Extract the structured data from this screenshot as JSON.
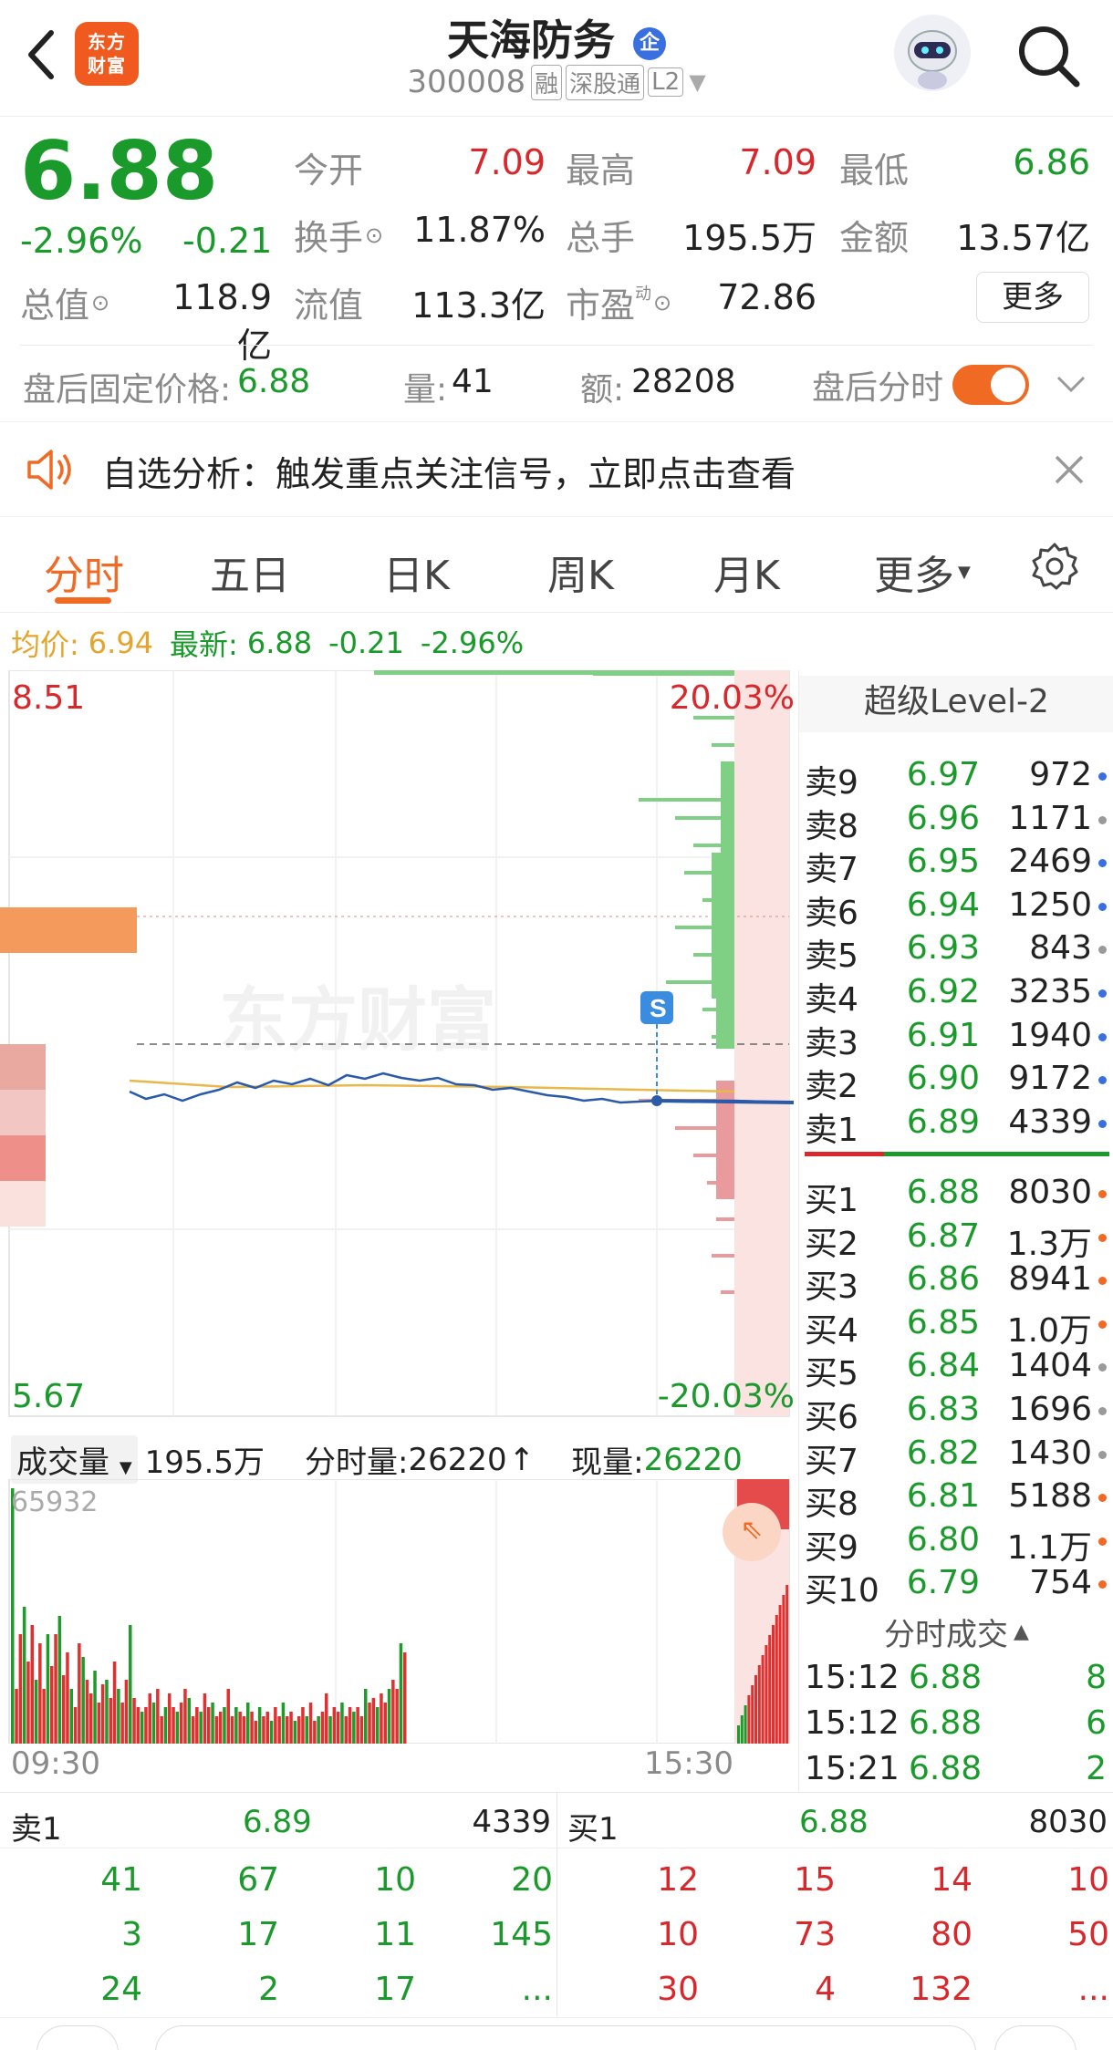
{
  "header": {
    "title": "天海防务",
    "title_badge": "企",
    "code": "300008",
    "tags": [
      "融",
      "深股通",
      "L2"
    ],
    "logo_text": "东方财富"
  },
  "quote": {
    "price": "6.88",
    "pct": "-2.96%",
    "chg": "-0.21",
    "rows": [
      [
        {
          "k": "今开",
          "v": "7.09",
          "c": "red"
        },
        {
          "k": "最高",
          "v": "7.09",
          "c": "red"
        },
        {
          "k": "最低",
          "v": "6.86",
          "c": "green"
        }
      ],
      [
        {
          "k": "换手",
          "v": "11.87%",
          "c": "dark"
        },
        {
          "k": "总手",
          "v": "195.5万",
          "c": "dark"
        },
        {
          "k": "金额",
          "v": "13.57亿",
          "c": "dark"
        }
      ],
      [
        {
          "k": "总值",
          "v": "118.9亿",
          "c": "dark"
        },
        {
          "k": "流值",
          "v": "113.3亿",
          "c": "dark"
        },
        {
          "k": "市盈",
          "v": "72.86",
          "c": "dark"
        }
      ]
    ],
    "pe_super": "动",
    "more_button": "更多"
  },
  "after_hours": {
    "fixed_price_label": "盘后固定价格:",
    "fixed_price": "6.88",
    "vol_label": "量:",
    "vol": "41",
    "amt_label": "额:",
    "amt": "28208",
    "toggle_label": "盘后分时",
    "toggle_on": true
  },
  "notice": {
    "text": "自选分析：触发重点关注信号，立即点击查看"
  },
  "tabs": [
    "分时",
    "五日",
    "日K",
    "周K",
    "月K",
    "更多"
  ],
  "active_tab": 0,
  "legend": {
    "avg_label": "均价:",
    "avg_value": "6.94",
    "latest_label": "最新:",
    "latest_value": "6.88",
    "latest_chg": "-0.21",
    "latest_pct": "-2.96%"
  },
  "chart": {
    "top_price": "8.51",
    "bottom_price": "5.67",
    "top_pct": "20.03%",
    "bottom_pct": "-20.03%",
    "watermark": "东方财富",
    "signal_badge": "S",
    "volume_selector": "成交量",
    "volume_total": "195.5万",
    "tick_vol_label": "分时量:",
    "tick_vol": "26220",
    "current_vol_label": "现量:",
    "current_vol": "26220",
    "volume_max": "65932",
    "time_start": "09:30",
    "time_end": "15:30",
    "colors": {
      "up": "#e03030",
      "down": "#1e9b2a",
      "price_line": "#2a5aa8",
      "avg_line": "#e8b84a"
    }
  },
  "order_book": {
    "title": "超级Level-2",
    "asks": [
      {
        "label": "卖9",
        "price": "6.97",
        "vol": "972",
        "dot": "blue"
      },
      {
        "label": "卖8",
        "price": "6.96",
        "vol": "1171",
        "dot": "gray"
      },
      {
        "label": "卖7",
        "price": "6.95",
        "vol": "2469",
        "dot": "blue"
      },
      {
        "label": "卖6",
        "price": "6.94",
        "vol": "1250",
        "dot": "blue"
      },
      {
        "label": "卖5",
        "price": "6.93",
        "vol": "843",
        "dot": "gray"
      },
      {
        "label": "卖4",
        "price": "6.92",
        "vol": "3235",
        "dot": "blue"
      },
      {
        "label": "卖3",
        "price": "6.91",
        "vol": "1940",
        "dot": "blue"
      },
      {
        "label": "卖2",
        "price": "6.90",
        "vol": "9172",
        "dot": "blue"
      },
      {
        "label": "卖1",
        "price": "6.89",
        "vol": "4339",
        "dot": "blue"
      }
    ],
    "bids": [
      {
        "label": "买1",
        "price": "6.88",
        "vol": "8030",
        "dot": "orange"
      },
      {
        "label": "买2",
        "price": "6.87",
        "vol": "1.3万",
        "dot": "orange"
      },
      {
        "label": "买3",
        "price": "6.86",
        "vol": "8941",
        "dot": "orange"
      },
      {
        "label": "买4",
        "price": "6.85",
        "vol": "1.0万",
        "dot": "orange"
      },
      {
        "label": "买5",
        "price": "6.84",
        "vol": "1404",
        "dot": "gray"
      },
      {
        "label": "买6",
        "price": "6.83",
        "vol": "1696",
        "dot": "gray"
      },
      {
        "label": "买7",
        "price": "6.82",
        "vol": "1430",
        "dot": "gray"
      },
      {
        "label": "买8",
        "price": "6.81",
        "vol": "5188",
        "dot": "orange"
      },
      {
        "label": "买9",
        "price": "6.80",
        "vol": "1.1万",
        "dot": "orange"
      },
      {
        "label": "买10",
        "price": "6.79",
        "vol": "754",
        "dot": "orange"
      }
    ],
    "ticks_title": "分时成交",
    "ticks": [
      {
        "time": "15:12",
        "price": "6.88",
        "vol": "8"
      },
      {
        "time": "15:12",
        "price": "6.88",
        "vol": "6"
      },
      {
        "time": "15:21",
        "price": "6.88",
        "vol": "2"
      }
    ]
  },
  "queues": {
    "ask_label": "卖1",
    "ask_price": "6.89",
    "ask_total": "4339",
    "bid_label": "买1",
    "bid_price": "6.88",
    "bid_total": "8030",
    "ask_cells": [
      "41",
      "67",
      "10",
      "20",
      "3",
      "17",
      "11",
      "145",
      "24",
      "2",
      "17",
      "..."
    ],
    "bid_cells": [
      "12",
      "15",
      "14",
      "10",
      "10",
      "73",
      "80",
      "50",
      "30",
      "4",
      "132",
      "..."
    ]
  }
}
